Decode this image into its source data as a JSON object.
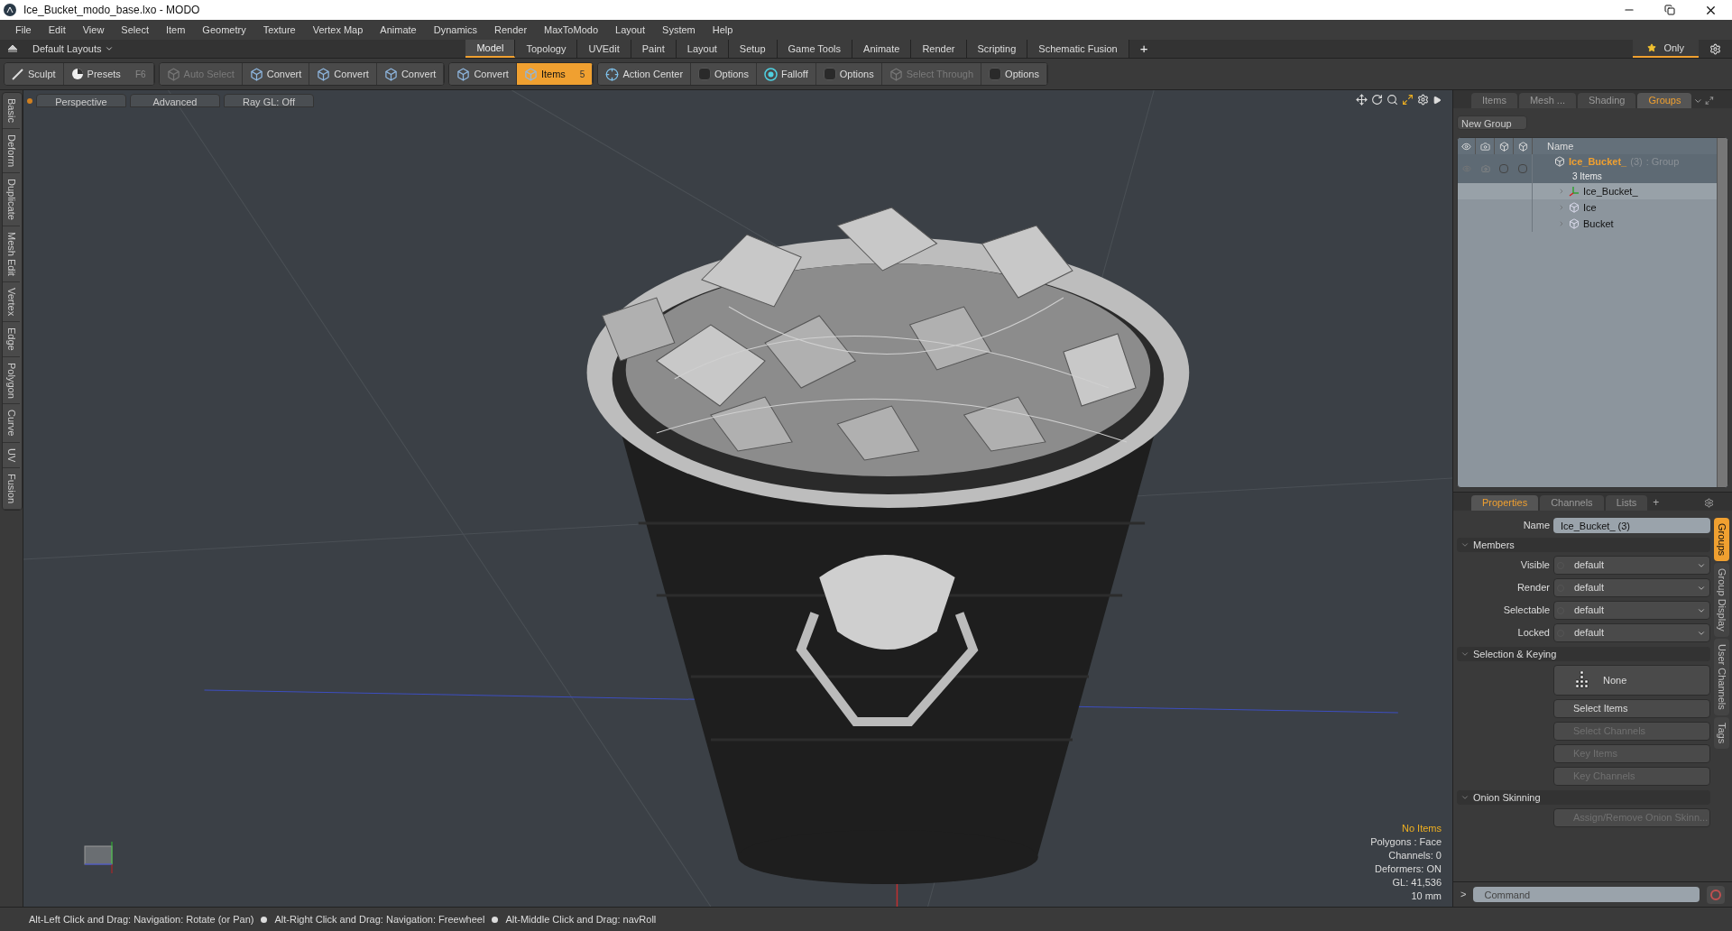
{
  "window": {
    "title": "Ice_Bucket_modo_base.lxo - MODO"
  },
  "menu": [
    "File",
    "Edit",
    "View",
    "Select",
    "Item",
    "Geometry",
    "Texture",
    "Vertex Map",
    "Animate",
    "Dynamics",
    "Render",
    "MaxToModo",
    "Layout",
    "System",
    "Help"
  ],
  "layout_bar": {
    "preset": "Default Layouts",
    "tabs": [
      {
        "label": "Model",
        "selected": true
      },
      {
        "label": "Topology",
        "selected": false
      },
      {
        "label": "UVEdit",
        "selected": false
      },
      {
        "label": "Paint",
        "selected": false
      },
      {
        "label": "Layout",
        "selected": false
      },
      {
        "label": "Setup",
        "selected": false
      },
      {
        "label": "Game Tools",
        "selected": false
      },
      {
        "label": "Animate",
        "selected": false
      },
      {
        "label": "Render",
        "selected": false
      },
      {
        "label": "Scripting",
        "selected": false
      },
      {
        "label": "Schematic Fusion",
        "selected": false
      }
    ],
    "add": "+",
    "only": "Only"
  },
  "toolbar": [
    {
      "buttons": [
        {
          "label": "Sculpt",
          "kind": "brush",
          "disabled": false,
          "selected": false
        },
        {
          "label": "Presets",
          "kind": "presets",
          "shortcut": "F6",
          "disabled": false,
          "selected": false
        }
      ]
    },
    {
      "buttons": [
        {
          "label": "Auto Select",
          "kind": "cube",
          "disabled": true,
          "selected": false
        },
        {
          "label": "Convert",
          "kind": "cube",
          "disabled": false,
          "selected": false
        },
        {
          "label": "Convert",
          "kind": "cube",
          "disabled": false,
          "selected": false
        },
        {
          "label": "Convert",
          "kind": "cube",
          "disabled": false,
          "selected": false
        }
      ]
    },
    {
      "buttons": [
        {
          "label": "Convert",
          "kind": "cube",
          "disabled": false,
          "selected": false
        },
        {
          "label": "Items",
          "kind": "cube",
          "shortcut": "5",
          "disabled": false,
          "selected": true
        }
      ]
    },
    {
      "buttons": [
        {
          "label": "Action Center",
          "kind": "crosshair",
          "disabled": false,
          "selected": false
        },
        {
          "label": "Options",
          "kind": "square",
          "disabled": false,
          "selected": false
        },
        {
          "label": "Falloff",
          "kind": "target",
          "disabled": false,
          "selected": false
        },
        {
          "label": "Options",
          "kind": "square",
          "disabled": false,
          "selected": false
        },
        {
          "label": "Select Through",
          "kind": "cube",
          "disabled": true,
          "selected": false
        },
        {
          "label": "Options",
          "kind": "square",
          "disabled": false,
          "selected": false
        }
      ]
    }
  ],
  "left_tabs": [
    "Basic",
    "Deform",
    "Duplicate",
    "Mesh Edit",
    "Vertex",
    "Edge",
    "Polygon",
    "Curve",
    "UV",
    "Fusion"
  ],
  "viewport": {
    "buttons": [
      "Perspective",
      "Advanced",
      "Ray GL: Off"
    ],
    "info": [
      {
        "text": "No Items",
        "kind": "title"
      },
      {
        "text": "Polygons : Face",
        "kind": "stat"
      },
      {
        "text": "Channels: 0",
        "kind": "stat"
      },
      {
        "text": "Deformers: ON",
        "kind": "stat"
      },
      {
        "text": "GL: 41,536",
        "kind": "stat"
      },
      {
        "text": "10 mm",
        "kind": "stat"
      }
    ]
  },
  "status_bar": [
    "Alt-Left Click and Drag: Navigation: Rotate (or Pan)",
    "Alt-Right Click and Drag: Navigation: Freewheel",
    "Alt-Middle Click and Drag: navRoll"
  ],
  "groups_panel": {
    "tabs": [
      {
        "label": "Items",
        "selected": false
      },
      {
        "label": "Mesh ...",
        "selected": false
      },
      {
        "label": "Shading",
        "selected": false
      },
      {
        "label": "Groups",
        "selected": true
      }
    ],
    "new_group": "New Group",
    "column": "Name",
    "tree": [
      {
        "name": "Ice_Bucket_",
        "count": "(3)",
        "type": ": Group",
        "subtitle": "3 Items",
        "selected": true,
        "children": [
          {
            "name": "Ice_Bucket_",
            "kind": "locator",
            "selected": true
          },
          {
            "name": "Ice",
            "kind": "mesh",
            "selected": false
          },
          {
            "name": "Bucket",
            "kind": "mesh",
            "selected": false
          }
        ]
      }
    ]
  },
  "properties_panel": {
    "tabs": [
      {
        "label": "Properties",
        "selected": true
      },
      {
        "label": "Channels",
        "selected": false
      },
      {
        "label": "Lists",
        "selected": false
      }
    ],
    "add": "+",
    "name_label": "Name",
    "name_value": "Ice_Bucket_ (3)",
    "sections": [
      {
        "title": "Members",
        "expanded": true,
        "rows": [
          {
            "kind": "dropdown",
            "label": "Visible",
            "value": "default"
          },
          {
            "kind": "dropdown",
            "label": "Render",
            "value": "default"
          },
          {
            "kind": "dropdown",
            "label": "Selectable",
            "value": "default"
          },
          {
            "kind": "dropdown",
            "label": "Locked",
            "value": "default"
          }
        ]
      },
      {
        "title": "Selection & Keying",
        "expanded": true,
        "rows": [
          {
            "kind": "selector",
            "value": "None"
          },
          {
            "kind": "button",
            "value": "Select Items",
            "disabled": false
          },
          {
            "kind": "button",
            "value": "Select Channels",
            "disabled": true
          },
          {
            "kind": "button",
            "value": "Key Items",
            "disabled": true
          },
          {
            "kind": "button",
            "value": "Key Channels",
            "disabled": true
          }
        ]
      },
      {
        "title": "Onion Skinning",
        "expanded": true,
        "rows": [
          {
            "kind": "button",
            "value": "Assign/Remove Onion Skinn...",
            "disabled": true
          }
        ]
      }
    ],
    "side_tabs": [
      {
        "label": "Groups",
        "selected": true
      },
      {
        "label": "Group Display",
        "selected": false
      },
      {
        "label": "User Channels",
        "selected": false
      },
      {
        "label": "Tags",
        "selected": false
      }
    ]
  },
  "command": {
    "prompt": ">",
    "placeholder": "Command"
  }
}
